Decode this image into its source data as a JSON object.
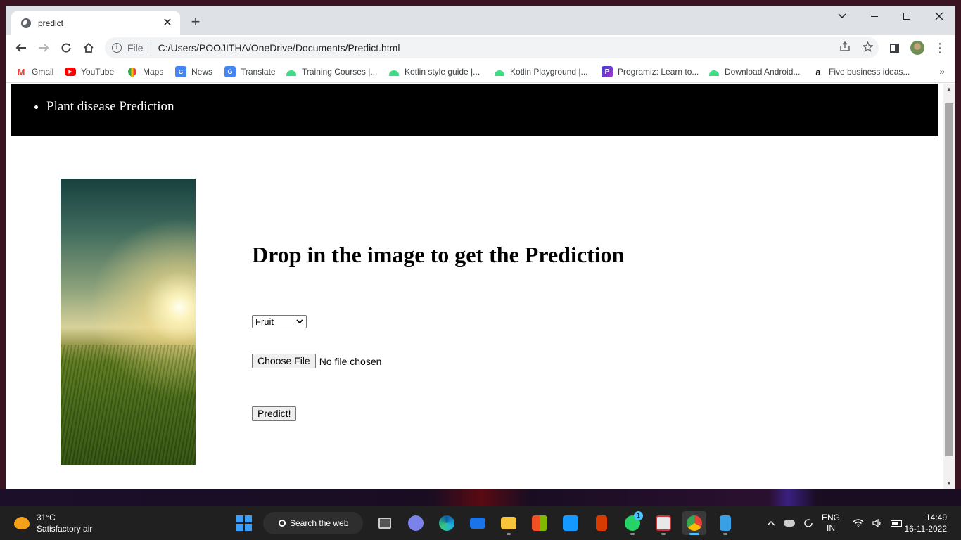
{
  "browser": {
    "tab_title": "predict",
    "tab_close": "✕",
    "new_tab": "+",
    "address_scheme": "File",
    "address_url": "C:/Users/POOJITHA/OneDrive/Documents/Predict.html"
  },
  "bookmarks": [
    {
      "label": "Gmail",
      "icon": "gmail-icon"
    },
    {
      "label": "YouTube",
      "icon": "youtube-icon"
    },
    {
      "label": "Maps",
      "icon": "maps-icon"
    },
    {
      "label": "News",
      "icon": "news-icon"
    },
    {
      "label": "Translate",
      "icon": "translate-icon"
    },
    {
      "label": "Training Courses |...",
      "icon": "android-icon"
    },
    {
      "label": "Kotlin style guide |...",
      "icon": "android-icon"
    },
    {
      "label": "Kotlin Playground |...",
      "icon": "android-icon"
    },
    {
      "label": "Programiz: Learn to...",
      "icon": "programiz-icon"
    },
    {
      "label": "Download Android...",
      "icon": "android-icon"
    },
    {
      "label": "Five business ideas...",
      "icon": "amazon-icon"
    }
  ],
  "bookmarks_more": "»",
  "page": {
    "nav_item": "Plant disease Prediction",
    "heading": "Drop in the image to get the Prediction",
    "select_value": "Fruit",
    "file_button": "Choose File",
    "file_status": "No file chosen",
    "predict_button": "Predict!"
  },
  "taskbar": {
    "temperature": "31°C",
    "air_quality": "Satisfactory air",
    "search_label": "Search the web",
    "whatsapp_badge": "1",
    "lang_line1": "ENG",
    "lang_line2": "IN",
    "time": "14:49",
    "date": "16-11-2022"
  },
  "colors": {
    "nav_background": "#000000",
    "tabstrip": "#dee1e6",
    "taskbar": "#202020",
    "accent": "#4cc2ff"
  }
}
